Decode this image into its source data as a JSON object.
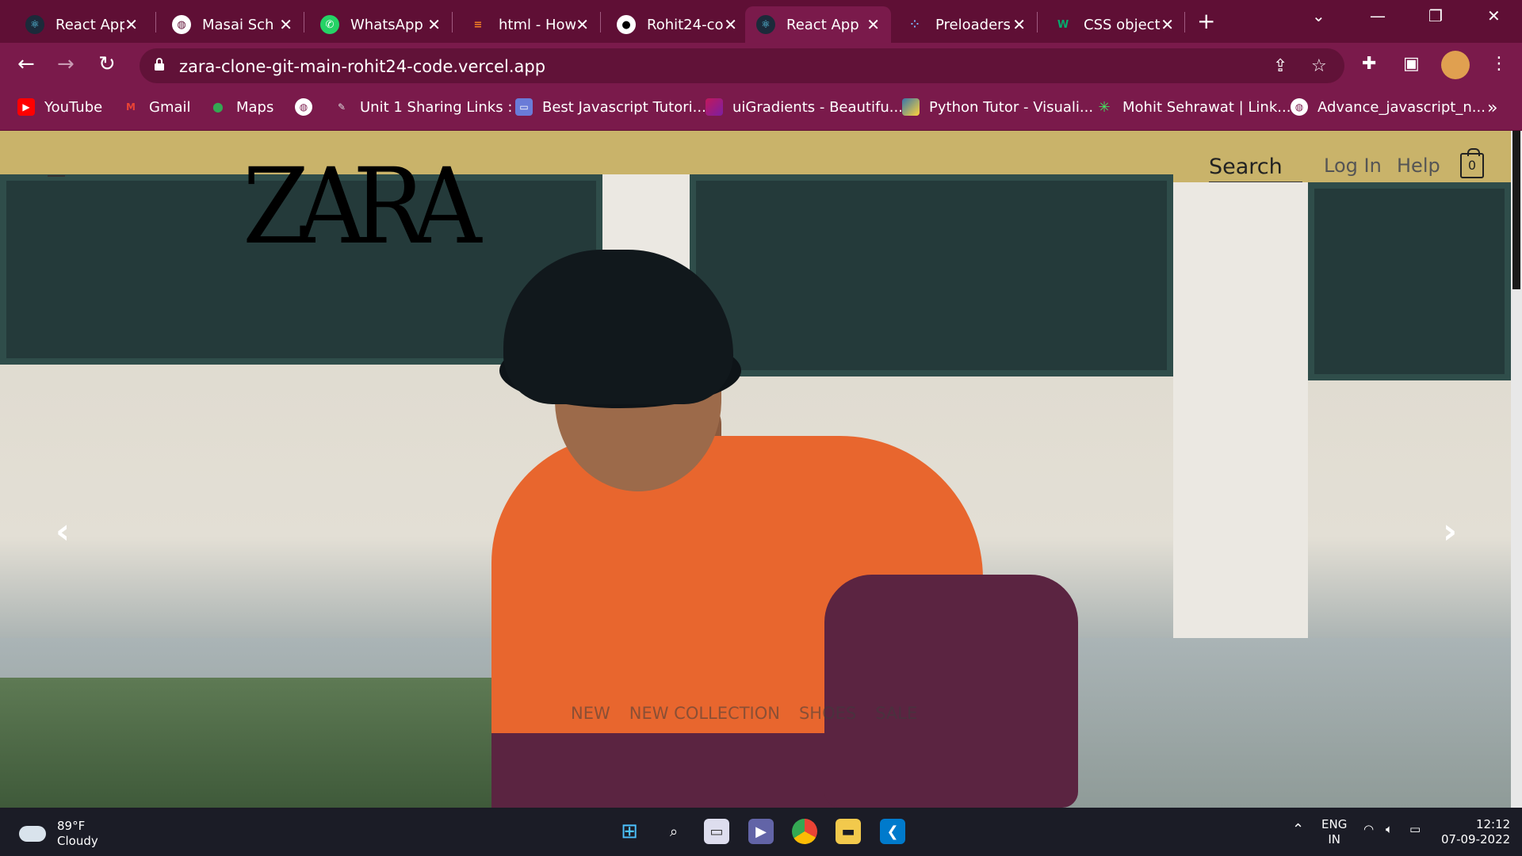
{
  "browser": {
    "tabs": [
      {
        "title": "React App",
        "favicon": "react-icon",
        "active": false
      },
      {
        "title": "Masai Sch",
        "favicon": "globe-icon",
        "active": false
      },
      {
        "title": "WhatsApp",
        "favicon": "whatsapp-icon",
        "active": false
      },
      {
        "title": "html - How",
        "favicon": "stackoverflow-icon",
        "active": false
      },
      {
        "title": "Rohit24-co",
        "favicon": "github-icon",
        "active": false
      },
      {
        "title": "React App",
        "favicon": "react-icon",
        "active": true
      },
      {
        "title": "Preloaders",
        "favicon": "dots-icon",
        "active": false
      },
      {
        "title": "CSS object",
        "favicon": "w3-icon",
        "active": false
      }
    ],
    "url": "zara-clone-git-main-rohit24-code.vercel.app",
    "bookmarks": [
      {
        "label": "YouTube",
        "icon": "youtube-icon",
        "color": "#ff0000"
      },
      {
        "label": "Gmail",
        "icon": "gmail-icon",
        "color": "#ea4335"
      },
      {
        "label": "Maps",
        "icon": "maps-icon",
        "color": "#34a853"
      },
      {
        "label": "",
        "icon": "globe-icon",
        "color": "#ffffff"
      },
      {
        "label": "Unit 1 Sharing Links :",
        "icon": "pen-icon",
        "color": "#cccccc"
      },
      {
        "label": "Best Javascript Tutori...",
        "icon": "monitor-icon",
        "color": "#6a7bd8"
      },
      {
        "label": "uiGradients - Beautifu...",
        "icon": "gradient-icon",
        "color": "#c2185b"
      },
      {
        "label": "Python Tutor - Visuali...",
        "icon": "python-icon",
        "color": "#3776ab"
      },
      {
        "label": "Mohit Sehrawat | Link...",
        "icon": "linktree-icon",
        "color": "#43e660"
      },
      {
        "label": "Advance_javascript_n...",
        "icon": "globe-icon",
        "color": "#ffffff"
      }
    ]
  },
  "site": {
    "logo": "ZARA",
    "search_label": "Search",
    "login_label": "Log In",
    "help_label": "Help",
    "bag_count": "0",
    "categories": [
      "NEW",
      "NEW COLLECTION",
      "SHOES",
      "SALE"
    ]
  },
  "taskbar": {
    "weather_temp": "89°F",
    "weather_desc": "Cloudy",
    "lang_top": "ENG",
    "lang_bottom": "IN",
    "time": "12:12",
    "date": "07-09-2022"
  },
  "colors": {
    "tabstrip": "#5f0f35",
    "toolbar": "#7a1a4b",
    "sweater": "#e8662e",
    "sleeve": "#5b2441"
  }
}
